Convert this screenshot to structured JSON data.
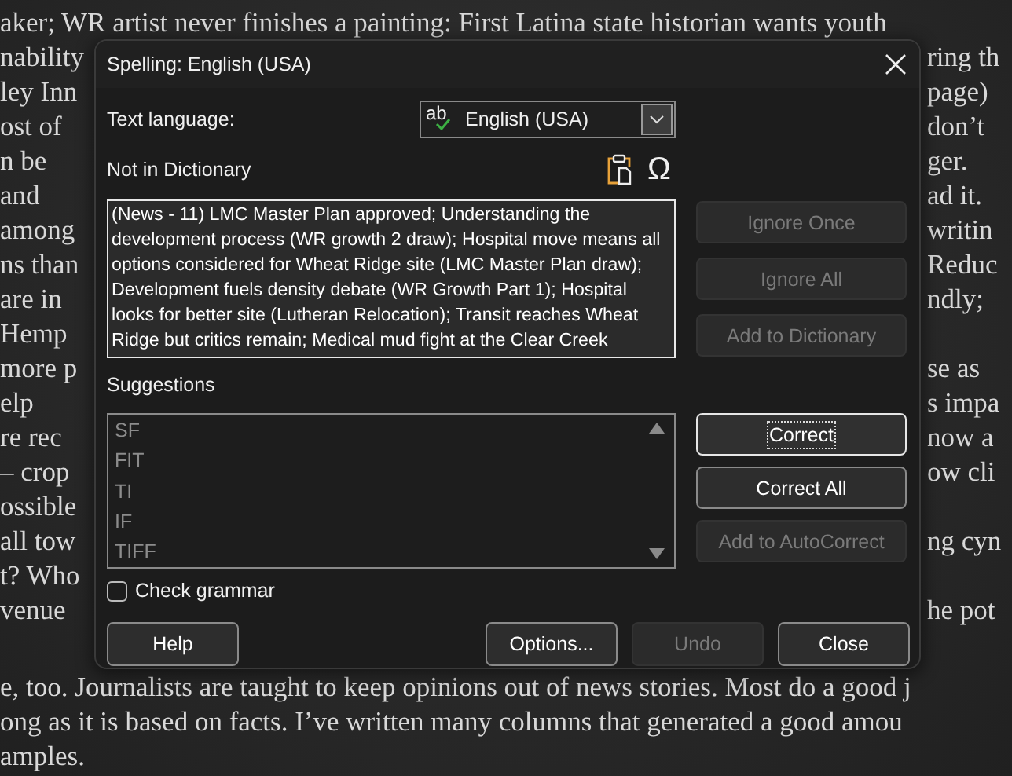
{
  "document": {
    "lines": [
      {
        "kind": "text",
        "left": "aker; WR artist never finishes a painting: First Latina state historian wants youth"
      },
      {
        "kind": "text",
        "left": "nability",
        "right": "ring th"
      },
      {
        "kind": "text",
        "left": "ley Inn",
        "right": "page)"
      },
      {
        "kind": "text",
        "left": "ost of",
        "right": "don’t"
      },
      {
        "kind": "text",
        "left": "n be",
        "right": "ger."
      },
      {
        "kind": "text",
        "left": "and",
        "right": "ad it."
      },
      {
        "kind": "text",
        "left": "among",
        "right": "writin"
      },
      {
        "kind": "text",
        "left": "ns than",
        "right": "Reduc"
      },
      {
        "kind": "text",
        "left": "are in",
        "right": "ndly;"
      },
      {
        "kind": "text",
        "left": "Hemp"
      },
      {
        "kind": "text",
        "left": "more p",
        "right": "se as"
      },
      {
        "kind": "text",
        "left": "elp",
        "right": "s impa"
      },
      {
        "kind": "text",
        "left": "re rec",
        "right": "now a"
      },
      {
        "kind": "text",
        "left": "– crop",
        "right": "ow cli"
      },
      {
        "kind": "text",
        "left": "ossible"
      },
      {
        "kind": "text",
        "left": "all tow",
        "right": "ng cyn"
      },
      {
        "kind": "text",
        "left": "t? Who"
      },
      {
        "kind": "text",
        "left": "venue",
        "right": "he pot"
      },
      {
        "kind": "blank"
      },
      {
        "kind": "text",
        "left": "e, too. Journalists are taught to keep opinions out of news stories. Most do a good j"
      },
      {
        "kind": "text",
        "left": "ong as it is based on facts. I’ve written many columns that generated a good amou"
      },
      {
        "kind": "text",
        "left": "amples."
      }
    ]
  },
  "dialog": {
    "title": "Spelling: English (USA)",
    "text_language": {
      "label": "Text language:",
      "icon_text": "ab",
      "value": "English (USA)"
    },
    "not_in_dictionary": {
      "label": "Not in Dictionary",
      "special_character": "Ω",
      "text_lines": [
        "(News - 11) LMC Master Plan approved; Understanding the",
        "development process (WR growth 2 draw); Hospital move means all",
        "options considered for Wheat Ridge site (LMC Master Plan draw);",
        "Development fuels density debate (WR Growth Part 1); Hospital",
        "looks for better site (Lutheran Relocation); Transit reaches Wheat",
        "Ridge but critics remain; Medical mud fight at the Clear Creek"
      ]
    },
    "side_buttons": [
      {
        "label": "Ignore Once",
        "disabled": true,
        "focused": false
      },
      {
        "label": "Ignore All",
        "disabled": true,
        "focused": false
      },
      {
        "label": "Add to Dictionary",
        "disabled": true,
        "focused": false
      }
    ],
    "suggestions": {
      "label": "Suggestions",
      "items": [
        {
          "text": "SF",
          "selected": false
        },
        {
          "text": "FIT",
          "selected": false
        },
        {
          "text": "TI",
          "selected": false
        },
        {
          "text": "IF",
          "selected": false
        },
        {
          "text": "TIFF",
          "selected": false
        }
      ]
    },
    "suggestion_buttons": [
      {
        "label": "Correct",
        "disabled": false,
        "focused": true
      },
      {
        "label": "Correct All",
        "disabled": false,
        "focused": false
      },
      {
        "label": "Add to AutoCorrect",
        "disabled": true,
        "focused": false
      }
    ],
    "check_grammar": {
      "label": "Check grammar",
      "checked": false
    },
    "footer_buttons": [
      {
        "label": "Help",
        "disabled": false,
        "focused": false
      },
      {
        "label": "Options...",
        "disabled": false,
        "focused": false
      },
      {
        "label": "Undo",
        "disabled": true,
        "focused": false
      },
      {
        "label": "Close",
        "disabled": false,
        "focused": false
      }
    ]
  }
}
